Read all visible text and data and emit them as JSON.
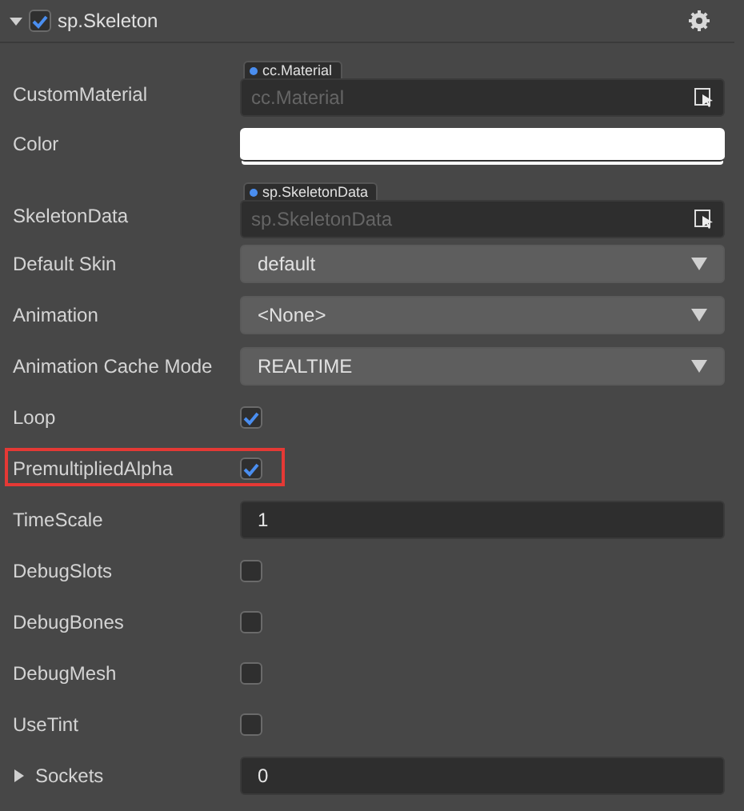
{
  "component": {
    "title": "sp.Skeleton",
    "expanded": true,
    "enabled": true
  },
  "properties": [
    {
      "kind": "asset",
      "label": "CustomMaterial",
      "type_tag": "cc.Material",
      "placeholder": "cc.Material"
    },
    {
      "kind": "color",
      "label": "Color",
      "color": "#ffffff"
    },
    {
      "kind": "asset",
      "label": "SkeletonData",
      "type_tag": "sp.SkeletonData",
      "placeholder": "sp.SkeletonData"
    },
    {
      "kind": "select",
      "label": "Default Skin",
      "value": "default"
    },
    {
      "kind": "select",
      "label": "Animation",
      "value": "<None>"
    },
    {
      "kind": "select",
      "label": "Animation Cache Mode",
      "value": "REALTIME"
    },
    {
      "kind": "checkbox",
      "label": "Loop",
      "checked": true,
      "highlighted": false
    },
    {
      "kind": "checkbox",
      "label": "PremultipliedAlpha",
      "checked": true,
      "highlighted": true
    },
    {
      "kind": "number",
      "label": "TimeScale",
      "value": "1"
    },
    {
      "kind": "checkbox",
      "label": "DebugSlots",
      "checked": false,
      "highlighted": false
    },
    {
      "kind": "checkbox",
      "label": "DebugBones",
      "checked": false,
      "highlighted": false
    },
    {
      "kind": "checkbox",
      "label": "DebugMesh",
      "checked": false,
      "highlighted": false
    },
    {
      "kind": "checkbox",
      "label": "UseTint",
      "checked": false,
      "highlighted": false
    },
    {
      "kind": "foldout",
      "label": "Sockets",
      "expanded": false,
      "value": "0"
    }
  ]
}
